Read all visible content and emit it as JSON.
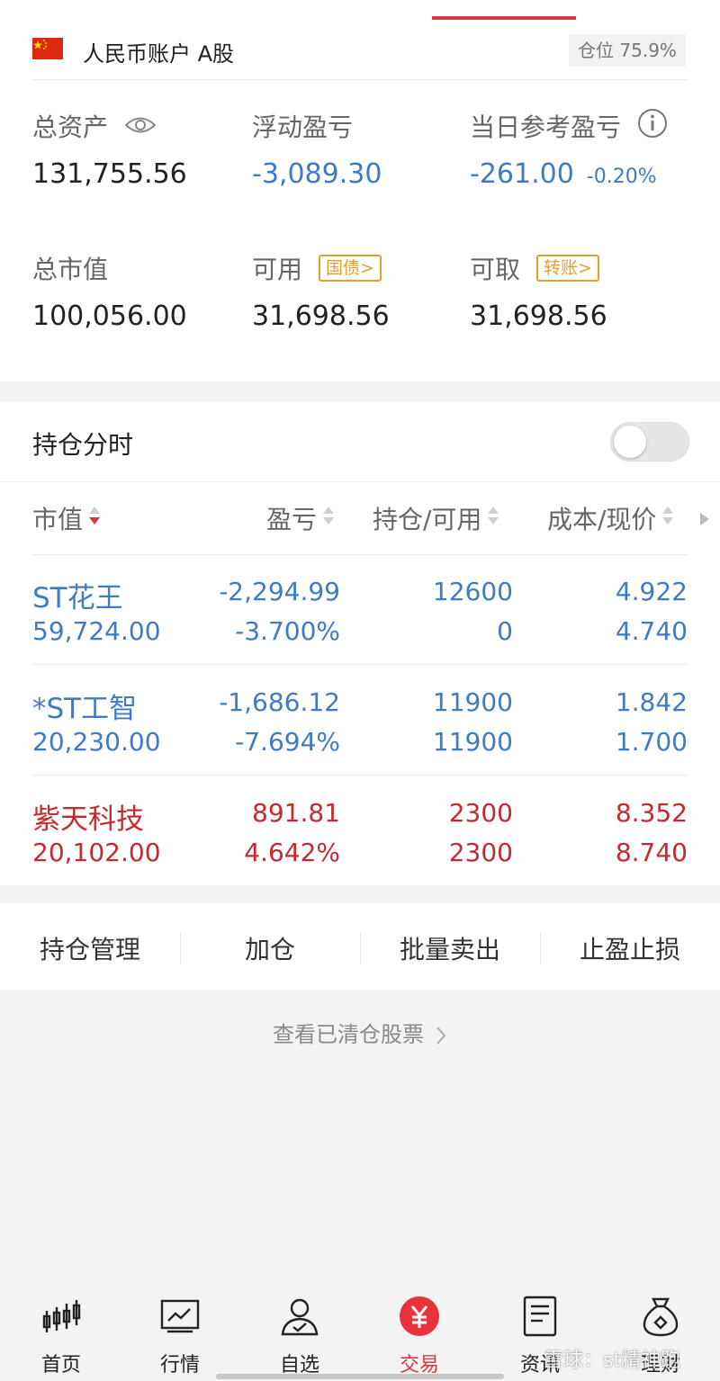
{
  "account": {
    "name": "人民币账户 A股",
    "position_ratio": "仓位 75.9%"
  },
  "summary": {
    "total_assets": {
      "label": "总资产",
      "value": "131,755.56"
    },
    "floating_pl": {
      "label": "浮动盈亏",
      "value": "-3,089.30"
    },
    "daily_pl": {
      "label": "当日参考盈亏",
      "value": "-261.00",
      "pct": "-0.20%"
    },
    "market_value": {
      "label": "总市值",
      "value": "100,056.00"
    },
    "available": {
      "label": "可用",
      "tag": "国债>",
      "value": "31,698.56"
    },
    "withdrawable": {
      "label": "可取",
      "tag": "转账>",
      "value": "31,698.56"
    }
  },
  "holding_time": {
    "label": "持仓分时",
    "enabled": false
  },
  "table": {
    "headers": [
      "市值",
      "盈亏",
      "持仓/可用",
      "成本/现价"
    ],
    "rows": [
      {
        "name": "ST花王",
        "market_value": "59,724.00",
        "pl": "-2,294.99",
        "pl_pct": "-3.700%",
        "position": "12600",
        "available": "0",
        "cost": "4.922",
        "price": "4.740",
        "tone": "blue"
      },
      {
        "name": "*ST工智",
        "market_value": "20,230.00",
        "pl": "-1,686.12",
        "pl_pct": "-7.694%",
        "position": "11900",
        "available": "11900",
        "cost": "1.842",
        "price": "1.700",
        "tone": "blue"
      },
      {
        "name": "紫天科技",
        "market_value": "20,102.00",
        "pl": "891.81",
        "pl_pct": "4.642%",
        "position": "2300",
        "available": "2300",
        "cost": "8.352",
        "price": "8.740",
        "tone": "red"
      }
    ]
  },
  "actions": [
    "持仓管理",
    "加仓",
    "批量卖出",
    "止盈止损"
  ],
  "cleared_link": "查看已清仓股票",
  "nav": [
    {
      "label": "首页",
      "icon": "candlestick-icon"
    },
    {
      "label": "行情",
      "icon": "chart-icon"
    },
    {
      "label": "自选",
      "icon": "user-check-icon"
    },
    {
      "label": "交易",
      "icon": "yuan-icon",
      "active": true
    },
    {
      "label": "资讯",
      "icon": "document-icon"
    },
    {
      "label": "理财",
      "icon": "money-bag-icon"
    }
  ],
  "watermark": "雪球：st精神跑",
  "colors": {
    "accent": "#d9363e",
    "loss": "#3f7bc4",
    "gain": "#c6292f",
    "tag": "#e4a02a"
  }
}
